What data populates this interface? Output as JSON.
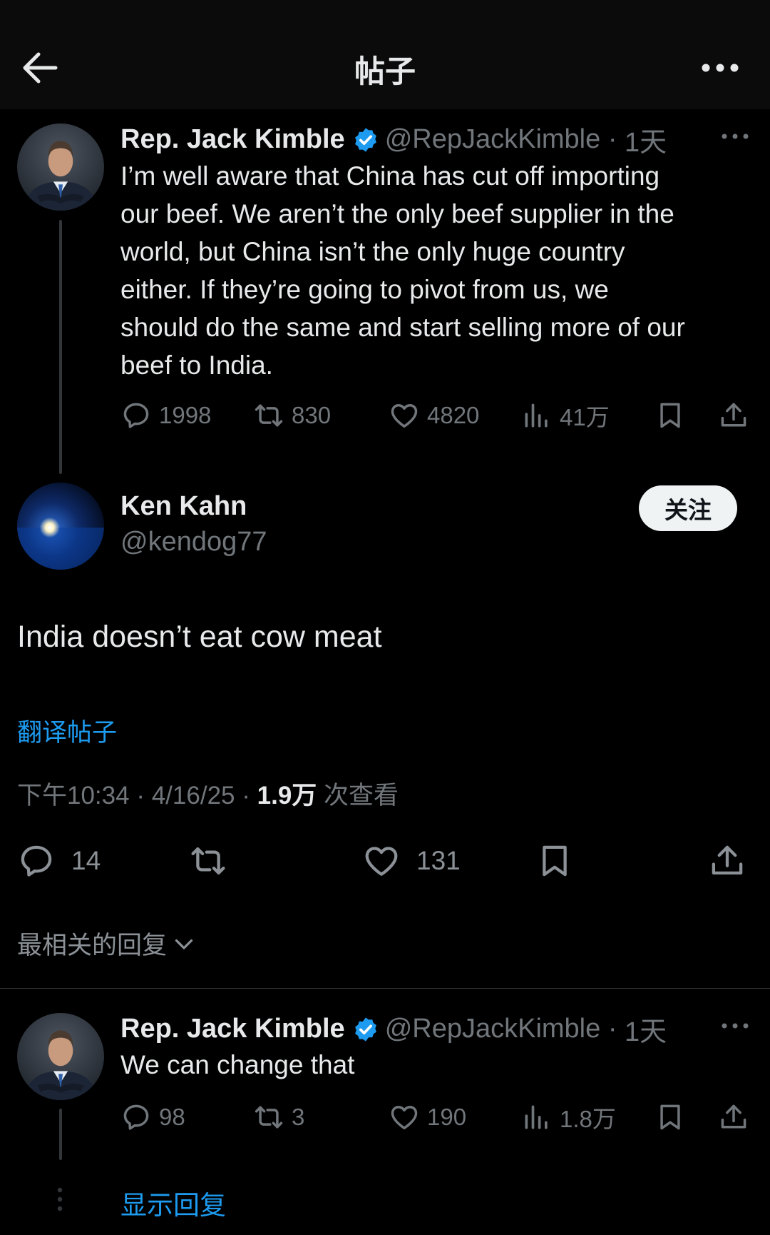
{
  "header": {
    "title": "帖子",
    "back_icon": "arrow-left-icon",
    "more_icon": "more-dots-icon"
  },
  "colors": {
    "background": "#000000",
    "text": "#e7e9ea",
    "muted": "#71767b",
    "link": "#1d9bf0",
    "verified": "#1d9bf0"
  },
  "parent_post": {
    "author": {
      "name": "Rep. Jack Kimble",
      "handle": "@RepJackKimble",
      "time": "1天",
      "verified": true
    },
    "text": "I’m well aware that China has cut off importing our beef. We aren’t the only beef supplier in the world, but China isn’t the only huge country either. If they’re going to pivot from us, we should do the same and start selling more of our beef to India.",
    "text_lines": [
      "I’m well aware that China has cut off importing",
      "our beef. We aren’t the only beef supplier in the",
      "world, but China isn’t the only huge country",
      "either. If they’re going to pivot from us, we",
      "should do the same and start selling more of our",
      "beef to India."
    ],
    "stats": {
      "replies": "1998",
      "reposts": "830",
      "likes": "4820",
      "views": "41万"
    }
  },
  "main_post": {
    "author": {
      "name": "Ken Kahn",
      "handle": "@kendog77"
    },
    "follow_label": "关注",
    "text": "India doesn’t eat cow meat",
    "translate_label": "翻译帖子",
    "meta": {
      "time": "下午10:34",
      "date": "4/16/25",
      "views_count": "1.9万",
      "views_suffix": "次查看"
    },
    "stats": {
      "replies": "14",
      "reposts": "",
      "likes": "131"
    }
  },
  "sort": {
    "label": "最相关的回复"
  },
  "reply": {
    "author": {
      "name": "Rep. Jack Kimble",
      "handle": "@RepJackKimble",
      "time": "1天",
      "verified": true
    },
    "text": "We can change that",
    "stats": {
      "replies": "98",
      "reposts": "3",
      "likes": "190",
      "views": "1.8万"
    },
    "show_replies_label": "显示回复"
  }
}
